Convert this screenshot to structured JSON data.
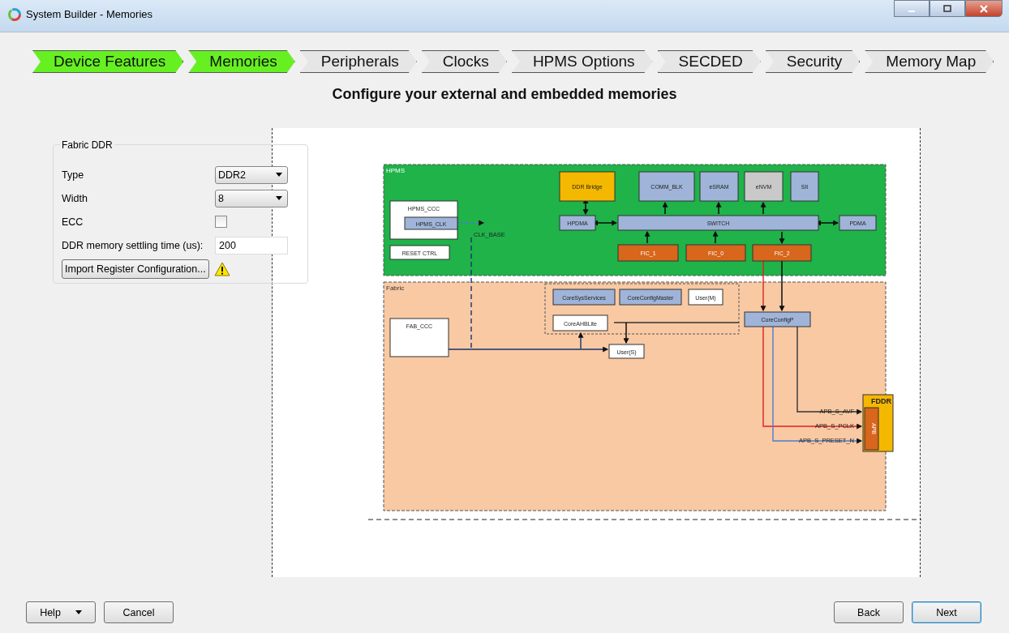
{
  "window": {
    "title": "System Builder - Memories"
  },
  "steps": [
    {
      "label": "Device Features",
      "done": true
    },
    {
      "label": "Memories",
      "done": true
    },
    {
      "label": "Peripherals",
      "done": false
    },
    {
      "label": "Clocks",
      "done": false
    },
    {
      "label": "HPMS Options",
      "done": false
    },
    {
      "label": "SECDED",
      "done": false
    },
    {
      "label": "Security",
      "done": false
    },
    {
      "label": "Memory Map",
      "done": false
    }
  ],
  "heading": "Configure your external and embedded memories",
  "fabric_ddr": {
    "title": "Fabric DDR",
    "type": {
      "label": "Type",
      "value": "DDR2"
    },
    "width": {
      "label": "Width",
      "value": "8"
    },
    "ecc": {
      "label": "ECC",
      "checked": false
    },
    "settling_time": {
      "label": "DDR memory settling time (us):",
      "value": "200"
    },
    "import_button": "Import Register Configuration..."
  },
  "diagram": {
    "regions": [
      {
        "label": "HPMS",
        "kind": "hpms"
      },
      {
        "label": "Fabric",
        "kind": "fabric"
      }
    ],
    "blocks": [
      {
        "label": "DDR Bridge",
        "kind": "yellow"
      },
      {
        "label": "COMM_BLK",
        "kind": "blue"
      },
      {
        "label": "eSRAM",
        "kind": "blue"
      },
      {
        "label": "eNVM",
        "kind": "grey"
      },
      {
        "label": "SII",
        "kind": "blue"
      },
      {
        "label": "HPMS_CCC",
        "kind": "white"
      },
      {
        "label": "HPMS_CLK",
        "kind": "blue"
      },
      {
        "label": "RESET CTRL",
        "kind": "white"
      },
      {
        "label": "HPDMA",
        "kind": "blue"
      },
      {
        "label": "SWITCH",
        "kind": "blue"
      },
      {
        "label": "PDMA",
        "kind": "blue"
      },
      {
        "label": "FIC_1",
        "kind": "orange"
      },
      {
        "label": "FIC_0",
        "kind": "orange"
      },
      {
        "label": "FIC_2",
        "kind": "orange"
      },
      {
        "label": "CoreSysServices",
        "kind": "blue"
      },
      {
        "label": "CoreConfigMaster",
        "kind": "blue"
      },
      {
        "label": "User(M)",
        "kind": "white"
      },
      {
        "label": "CoreAHBLite",
        "kind": "white"
      },
      {
        "label": "FAB_CCC",
        "kind": "white"
      },
      {
        "label": "User(S)",
        "kind": "white"
      },
      {
        "label": "CoreConfigP",
        "kind": "blue"
      },
      {
        "label": "FDDR",
        "kind": "yellow"
      },
      {
        "label": "APB",
        "kind": "orange"
      }
    ],
    "signals": [
      "CLK_BASE",
      "APB_S_AVF",
      "APB_S_PCLK",
      "APB_S_PRESET_N"
    ]
  },
  "buttons": {
    "help": "Help",
    "cancel": "Cancel",
    "back": "Back",
    "next": "Next"
  }
}
